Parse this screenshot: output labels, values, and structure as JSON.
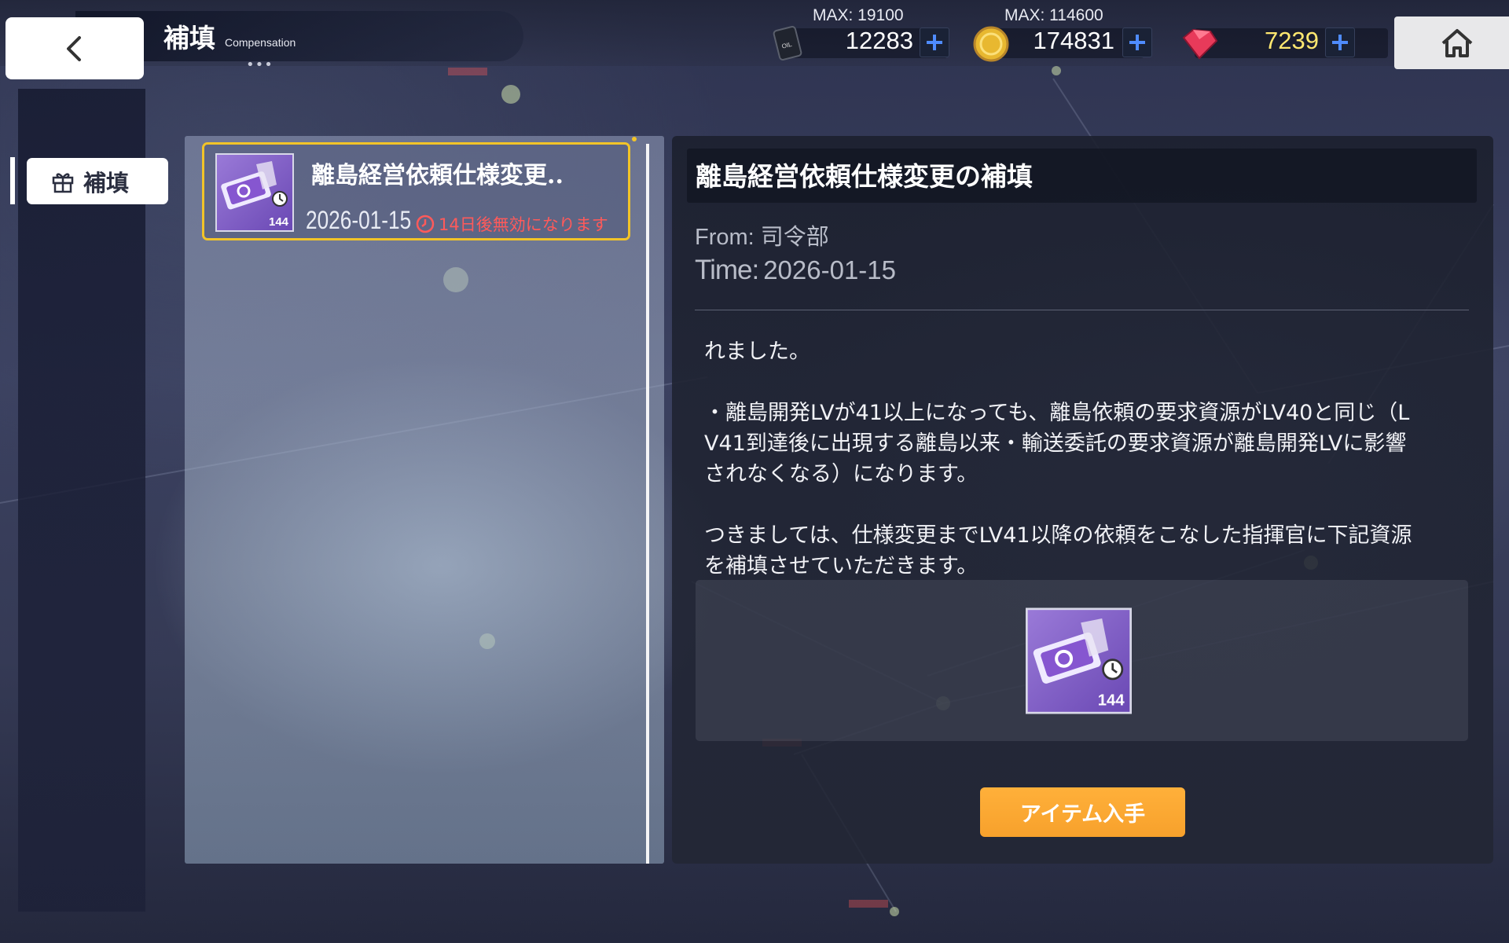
{
  "header": {
    "title": "補填",
    "subtitle": "Compensation",
    "dots": "•••"
  },
  "resources": [
    {
      "name": "oil",
      "icon": "oil-barrel-icon",
      "max": "MAX: 19100",
      "value": "12283",
      "color": "#ffffff"
    },
    {
      "name": "coins",
      "icon": "gold-coin-icon",
      "max": "MAX: 114600",
      "value": "174831",
      "color": "#ffffff"
    },
    {
      "name": "gems",
      "icon": "red-gem-icon",
      "max": "",
      "value": "7239",
      "color": "#ffe870"
    }
  ],
  "sidebar": {
    "items": [
      {
        "label": "補填",
        "icon": "gift-icon"
      }
    ]
  },
  "mail_list": [
    {
      "title": "離島経営依頼仕様変更..",
      "date": "2026-01-15",
      "expire": "14日後無効になります",
      "thumb_count": "144"
    }
  ],
  "detail": {
    "title": "離島経営依頼仕様変更の補填",
    "from": "From: 司令部",
    "time_label": "Time:",
    "time_value": "2026-01-15",
    "body": [
      "れました。",
      "",
      "・離島開発LVが41以上になっても、離島依頼の要求資源がLV40と同じ（L\nV41到達後に出現する離島以来・輸送委託の要求資源が離島開発LVに影響\nされなくなる）になります。",
      "",
      "つきましては、仕様変更までLV41以降の依頼をこなした指揮官に下記資源\nを補填させていただきます。"
    ],
    "reward_count": "144",
    "claim_label": "アイテム入手"
  },
  "colors": {
    "accent_orange": "#f7a12c",
    "selection_yellow": "#f2c428",
    "expire_red": "#ff5a5a",
    "plus_blue": "#4f8cff"
  }
}
